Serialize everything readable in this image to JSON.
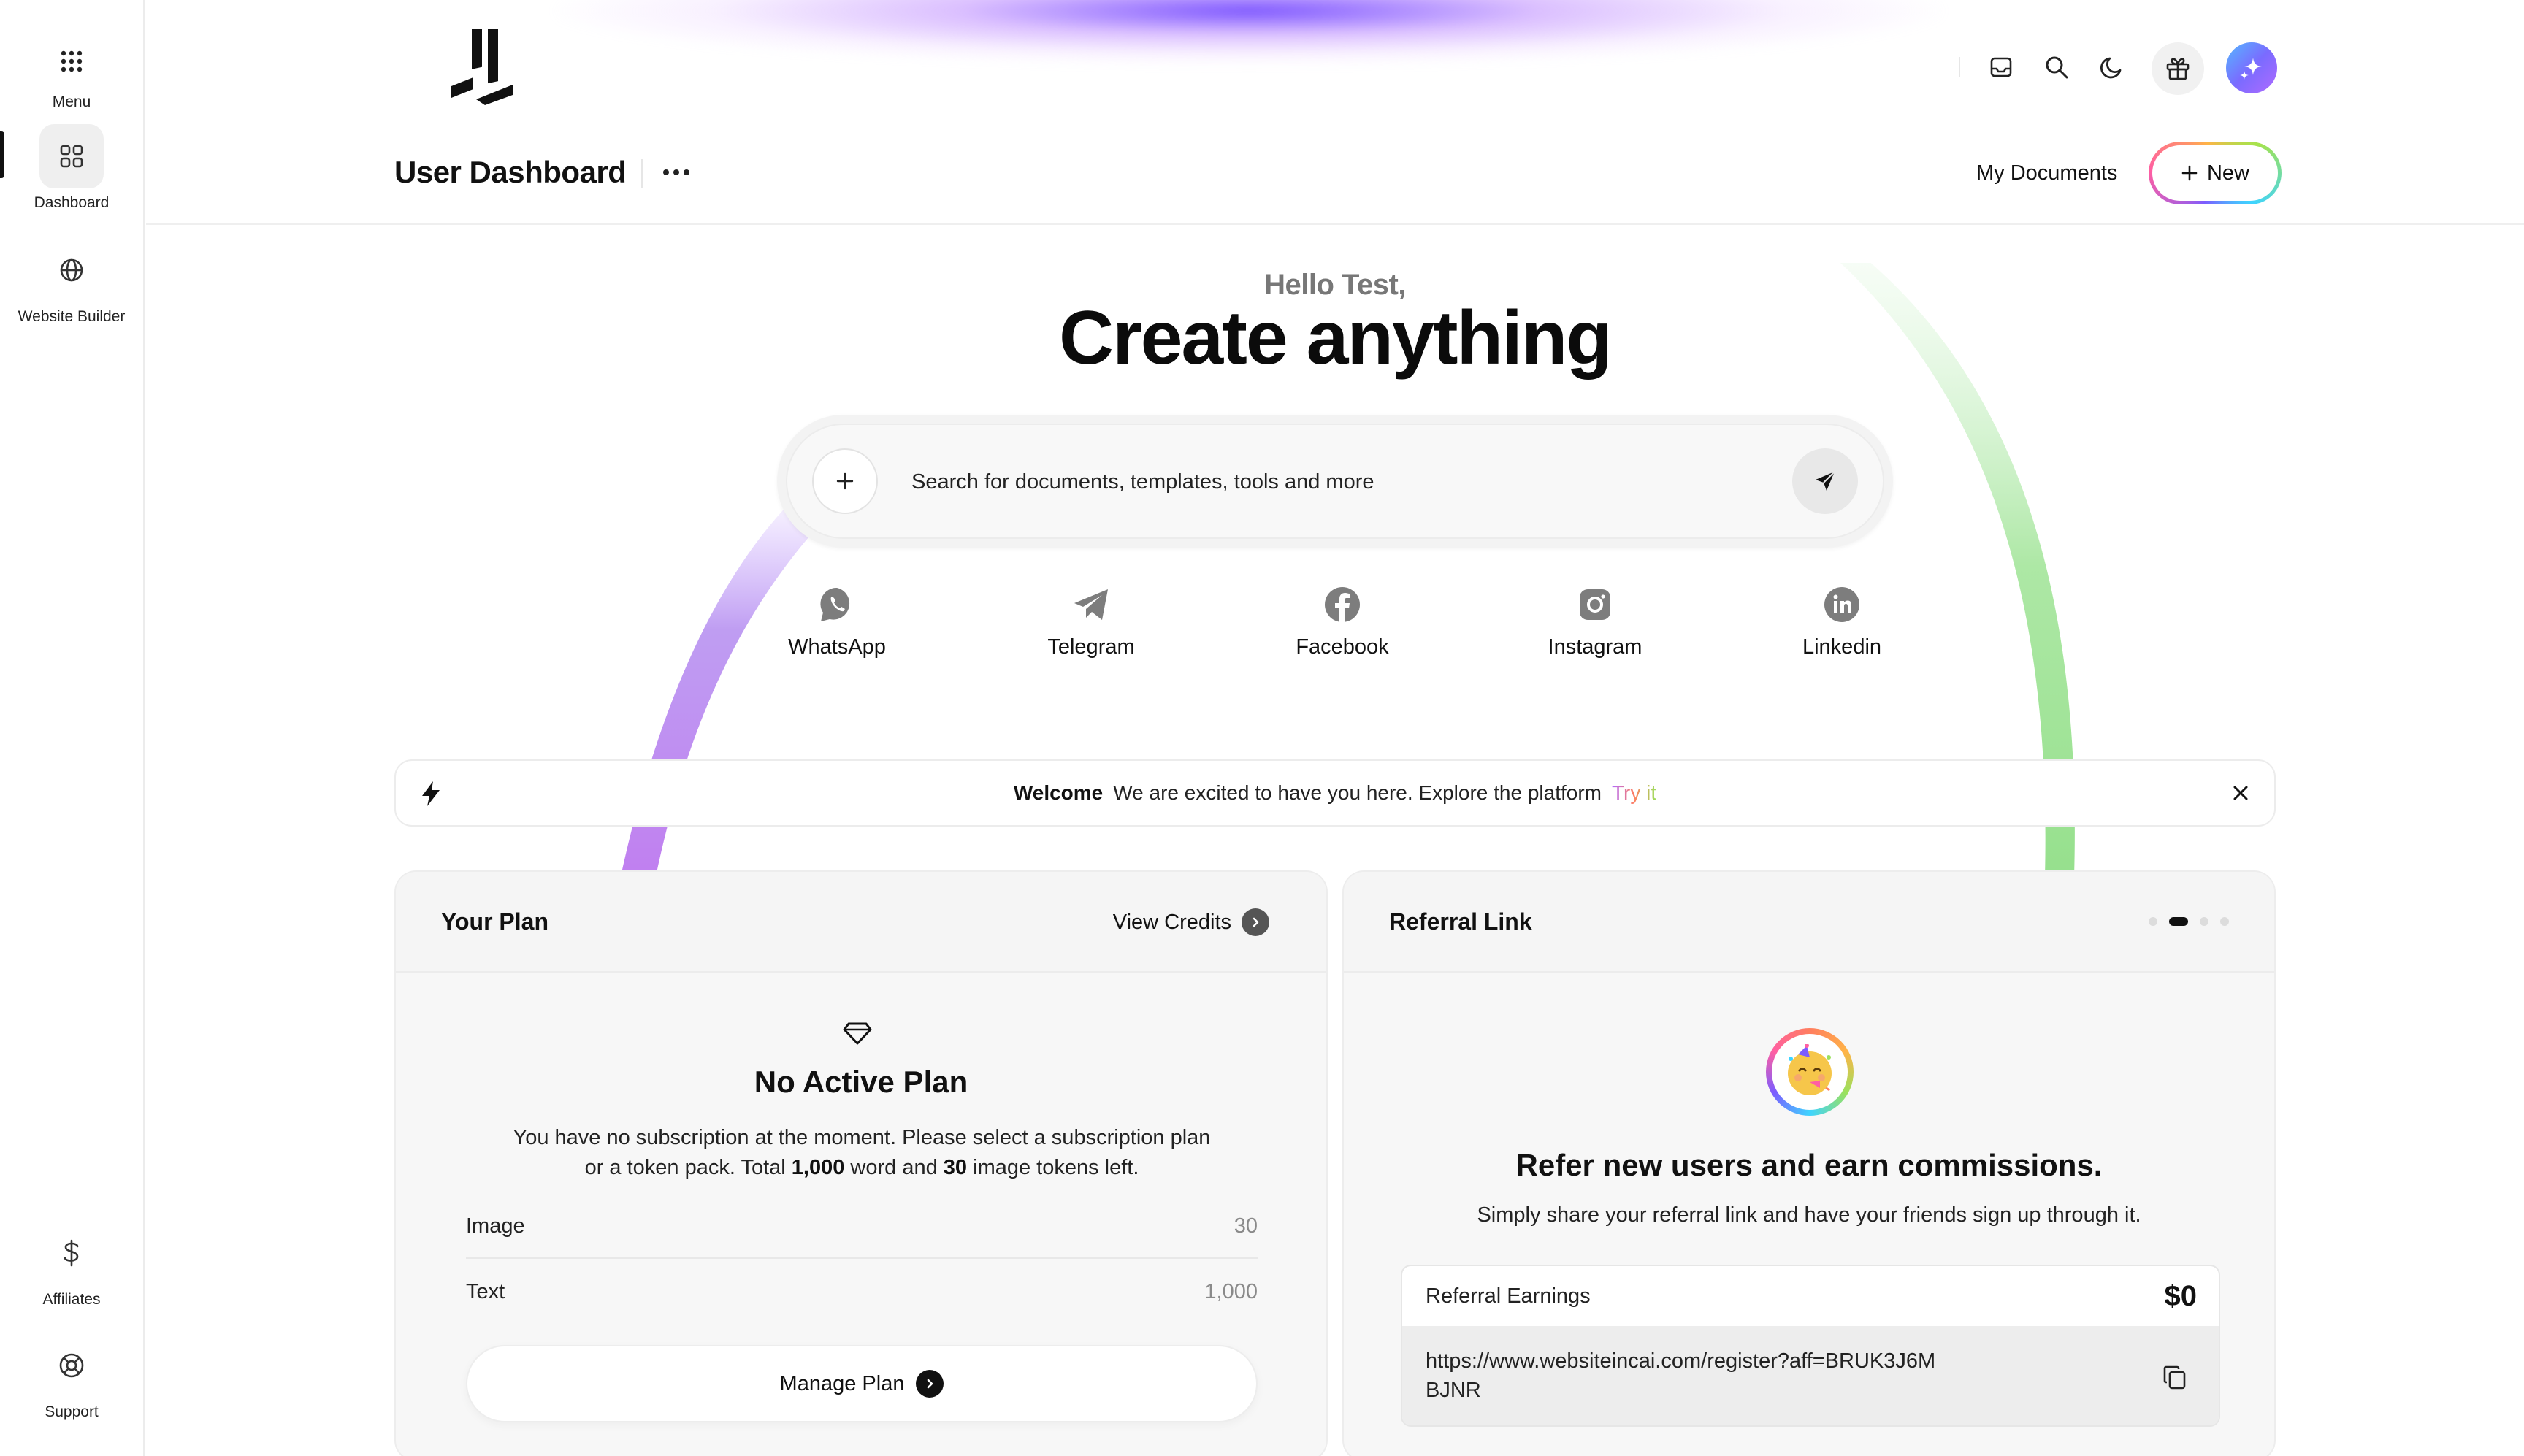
{
  "sidebar": {
    "items": [
      {
        "label": "Menu",
        "icon": "grid-dots-icon"
      },
      {
        "label": "Dashboard",
        "icon": "dashboard-icon"
      },
      {
        "label": "Website Builder",
        "icon": "globe-icon"
      },
      {
        "label": "Affiliates",
        "icon": "dollar-icon"
      },
      {
        "label": "Support",
        "icon": "lifebuoy-icon"
      }
    ],
    "active": "Dashboard"
  },
  "header": {
    "title": "User Dashboard",
    "my_documents": "My Documents",
    "new_label": "New",
    "icons": [
      "inbox-icon",
      "search-icon",
      "moon-icon",
      "gift-icon",
      "sparkle-avatar-icon"
    ]
  },
  "hero": {
    "greeting": "Hello Test,",
    "headline": "Create anything",
    "search_placeholder": "Search for documents, templates, tools and more"
  },
  "socials": [
    {
      "label": "WhatsApp",
      "icon": "whatsapp-icon"
    },
    {
      "label": "Telegram",
      "icon": "telegram-icon"
    },
    {
      "label": "Facebook",
      "icon": "facebook-icon"
    },
    {
      "label": "Instagram",
      "icon": "instagram-icon"
    },
    {
      "label": "Linkedin",
      "icon": "linkedin-icon"
    }
  ],
  "banner": {
    "title": "Welcome",
    "message": "We are excited to have you here. Explore the platform",
    "link": "Try it"
  },
  "plan": {
    "title": "Your Plan",
    "view_credits": "View Credits",
    "status_title": "No Active Plan",
    "desc_part1": "You have no subscription at the moment. Please select a subscription plan or a token pack. Total ",
    "words": "1,000",
    "desc_part2": " word and ",
    "images": "30",
    "desc_part3": " image tokens left.",
    "rows": [
      {
        "label": "Image",
        "value": "30"
      },
      {
        "label": "Text",
        "value": "1,000"
      }
    ],
    "manage_label": "Manage Plan"
  },
  "referral": {
    "title": "Referral Link",
    "carousel_active_index": 1,
    "carousel_count": 4,
    "headline": "Refer new users and earn commissions.",
    "subtitle": "Simply share your referral link and have your friends sign up through it.",
    "earnings_label": "Referral Earnings",
    "earnings_value": "$0",
    "link": "https://www.websiteincai.com/register?aff=BRUK3J6MBJNR"
  },
  "colors": {
    "accent_gradient": [
      "#7c5cff",
      "#ff5fa2",
      "#ffb347",
      "#9be15d",
      "#3ed4ff"
    ],
    "text": "#111111",
    "muted": "#8a8a8a"
  }
}
